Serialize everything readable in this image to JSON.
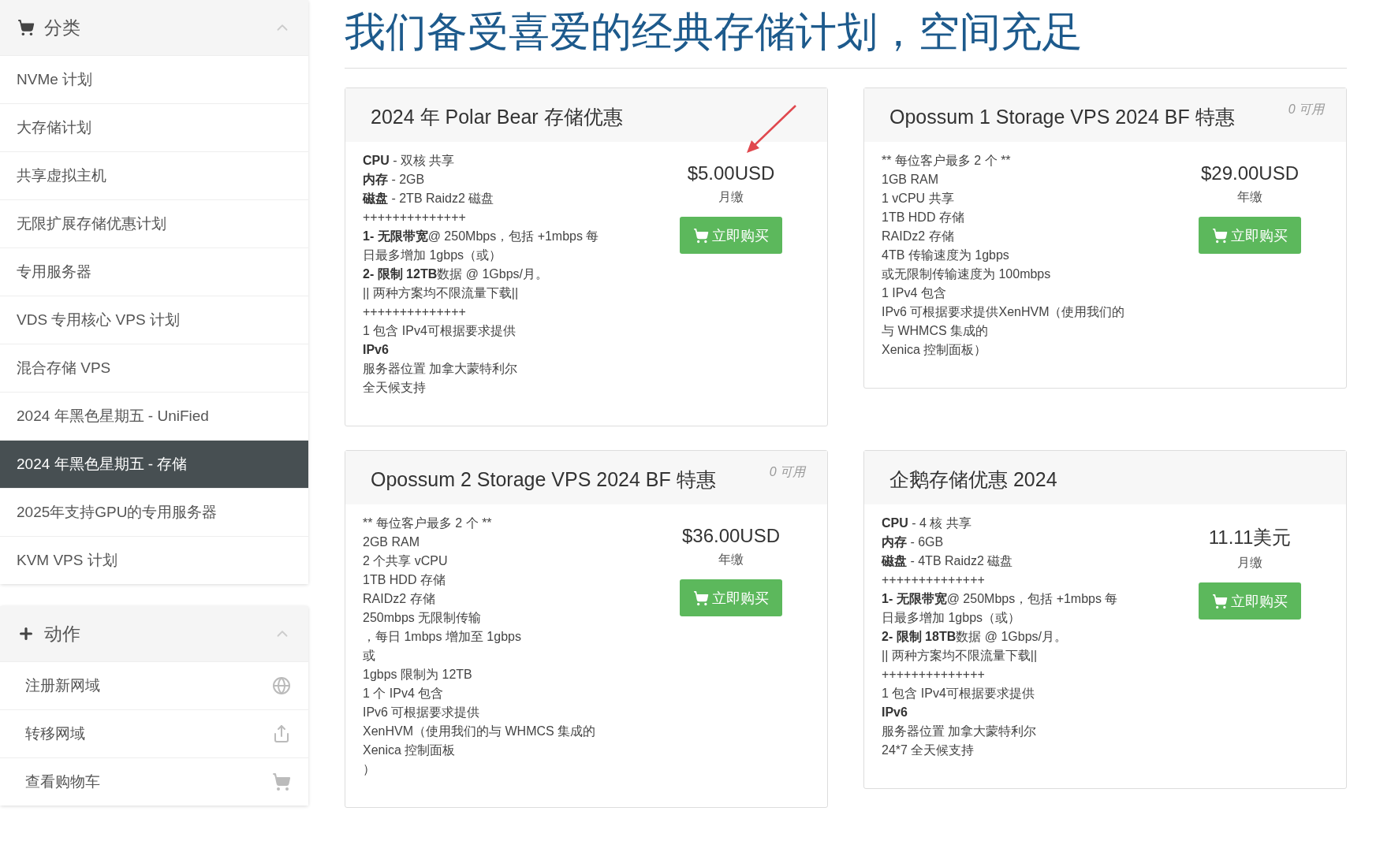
{
  "sidebar": {
    "categories": {
      "title": "分类",
      "expanded": true,
      "items": [
        {
          "label": "NVMe 计划",
          "selected": false
        },
        {
          "label": "大存储计划",
          "selected": false
        },
        {
          "label": "共享虚拟主机",
          "selected": false
        },
        {
          "label": "无限扩展存储优惠计划",
          "selected": false
        },
        {
          "label": "专用服务器",
          "selected": false
        },
        {
          "label": "VDS 专用核心 VPS 计划",
          "selected": false
        },
        {
          "label": "混合存储 VPS",
          "selected": false
        },
        {
          "label": "2024 年黑色星期五 - UniFied",
          "selected": false
        },
        {
          "label": "2024 年黑色星期五 - 存储",
          "selected": true
        },
        {
          "label": "2025年支持GPU的专用服务器",
          "selected": false
        },
        {
          "label": "KVM VPS 计划",
          "selected": false
        }
      ]
    },
    "actions": {
      "title": "动作",
      "expanded": true,
      "items": [
        {
          "label": "注册新网域",
          "kind": "globe"
        },
        {
          "label": "转移网域",
          "kind": "share"
        },
        {
          "label": "查看购物车",
          "kind": "cart"
        }
      ]
    }
  },
  "page_title": "我们备受喜爱的经典存储计划，空间充足",
  "products": [
    {
      "name": "2024 年 Polar Bear 存储优惠",
      "price": "$5.00USD",
      "cycle": "月缴",
      "button": "立即购买",
      "annotated": true,
      "description": [
        "**CPU** - 双核 共享",
        "**内存** - 2GB",
        "**磁盘** - 2TB Raidz2 磁盘",
        "++++++++++++++",
        "**1- 无限带宽**@ 250Mbps，包括 +1mbps 每",
        "日最多增加 1gbps（或）",
        "**2- 限制 12TB**数据 @ 1Gbps/月。",
        "|| 两种方案均不限流量下载||",
        "++++++++++++++",
        "1 包含 IPv4可根据要求提供",
        "**IPv6**",
        "服务器位置 加拿大蒙特利尔",
        "全天候支持"
      ]
    },
    {
      "name": "Opossum 1 Storage VPS 2024 BF 特惠",
      "availability": "0 可用",
      "price": "$29.00USD",
      "cycle": "年缴",
      "button": "立即购买",
      "annotated": false,
      "description": [
        "** 每位客户最多 2 个 **",
        "1GB RAM",
        "1 vCPU 共享",
        "1TB HDD 存储",
        "RAIDz2 存储",
        "4TB 传输速度为 1gbps",
        "或无限制传输速度为 100mbps",
        "1 IPv4 包含",
        "IPv6 可根据要求提供XenHVM（使用我们的",
        "与 WHMCS 集成的",
        "Xenica 控制面板）"
      ]
    },
    {
      "name": "Opossum 2 Storage VPS 2024 BF 特惠",
      "availability": "0 可用",
      "price": "$36.00USD",
      "cycle": "年缴",
      "button": "立即购买",
      "annotated": false,
      "description": [
        "** 每位客户最多 2 个 **",
        "2GB RAM",
        "2 个共享 vCPU",
        "1TB HDD 存储",
        "RAIDz2 存储",
        "250mbps 无限制传输",
        "，每日 1mbps 增加至 1gbps",
        "或",
        "1gbps 限制为 12TB",
        "1 个 IPv4 包含",
        "IPv6 可根据要求提供",
        "XenHVM（使用我们的与 WHMCS 集成的",
        "Xenica 控制面板",
        "）"
      ]
    },
    {
      "name": "企鹅存储优惠 2024",
      "price": "11.11美元",
      "cycle": "月缴",
      "button": "立即购买",
      "annotated": false,
      "description": [
        "**CPU** - 4 核 共享",
        "**内存** - 6GB",
        "**磁盘** - 4TB Raidz2 磁盘",
        "++++++++++++++",
        "**1- 无限带宽**@ 250Mbps，包括 +1mbps 每",
        "日最多增加 1gbps（或）",
        "**2- 限制 18TB**数据 @ 1Gbps/月。",
        "|| 两种方案均不限流量下载||",
        "++++++++++++++",
        "1 包含 IPv4可根据要求提供",
        "**IPv6**",
        "服务器位置 加拿大蒙特利尔",
        "24*7 全天候支持"
      ]
    }
  ]
}
